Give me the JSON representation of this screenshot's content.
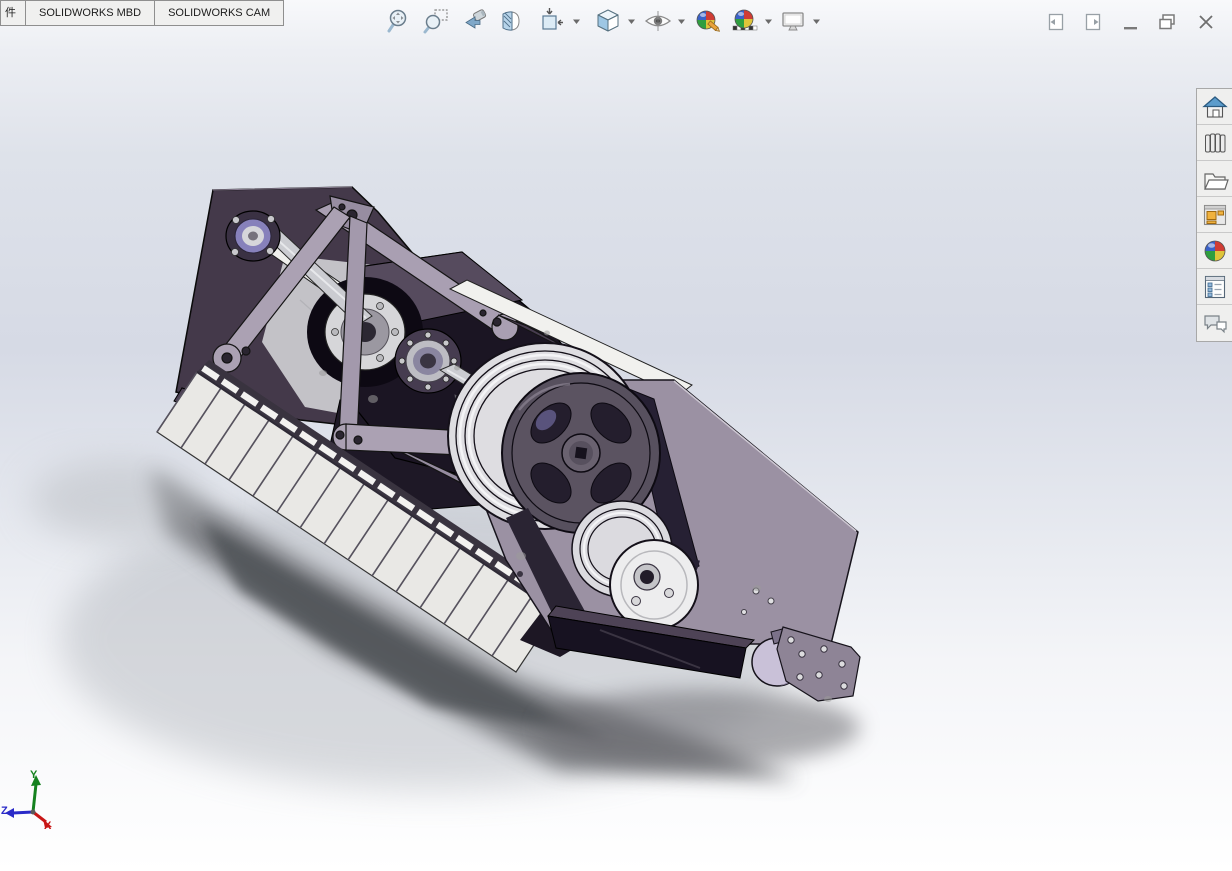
{
  "command_tabs": {
    "items": [
      {
        "label": "件"
      },
      {
        "label": "SOLIDWORKS MBD"
      },
      {
        "label": "SOLIDWORKS CAM"
      }
    ]
  },
  "heads_up_toolbar": {
    "buttons": [
      {
        "name": "zoom-to-fit-icon",
        "dropdown": false
      },
      {
        "name": "zoom-to-area-icon",
        "dropdown": false
      },
      {
        "name": "previous-view-icon",
        "dropdown": false
      },
      {
        "name": "section-view-icon",
        "dropdown": false
      },
      {
        "name": "view-orientation-icon",
        "dropdown": true
      },
      {
        "name": "display-style-icon",
        "dropdown": true
      },
      {
        "name": "hide-show-items-icon",
        "dropdown": true
      },
      {
        "name": "edit-appearance-icon",
        "dropdown": false
      },
      {
        "name": "apply-scene-icon",
        "dropdown": true
      },
      {
        "name": "view-settings-icon",
        "dropdown": true
      }
    ]
  },
  "window_controls": {
    "buttons": [
      "collapse-task-pane-left",
      "collapse-task-pane-right",
      "minimize",
      "restore",
      "close"
    ]
  },
  "task_pane": {
    "buttons": [
      "solidworks-resources",
      "design-library",
      "file-explorer",
      "view-palette",
      "appearances-scenes-decals",
      "custom-properties",
      "solidworks-forum"
    ]
  },
  "viewport": {
    "triad": {
      "x_label": "X",
      "y_label": "Y",
      "z_label": "Z",
      "x_color": "#c81616",
      "y_color": "#15821f",
      "z_color": "#2a2ac8"
    },
    "background": {
      "top": "#f8f9fb",
      "middle": "#d6dae5",
      "bottom": "#ffffff"
    },
    "model": {
      "palette": {
        "dark_plate": "#44394a",
        "side_plate": "#9b91a3",
        "arms": "#aba1b3",
        "slats": "#e9e8e5",
        "shaft": "#cbccd1",
        "pulley_wheel": "#57505e",
        "pulley_grooves": "#dedde1",
        "belt": "#262033",
        "roller": "#c9c1d8",
        "shadow": "#5f6065"
      }
    }
  }
}
